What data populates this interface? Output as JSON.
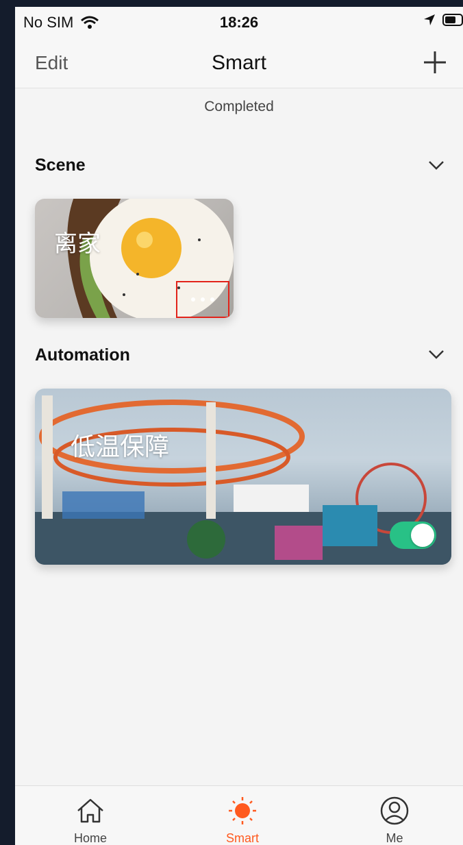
{
  "status_bar": {
    "carrier": "No SIM",
    "time": "18:26"
  },
  "nav": {
    "edit_label": "Edit",
    "title": "Smart"
  },
  "status_text": "Completed",
  "scene_section": {
    "title": "Scene",
    "items": [
      {
        "name": "离家"
      }
    ]
  },
  "automation_section": {
    "title": "Automation",
    "items": [
      {
        "name": "低温保障",
        "enabled": true
      }
    ]
  },
  "tabs": [
    {
      "label": "Home",
      "icon": "home-icon"
    },
    {
      "label": "Smart",
      "icon": "sun-icon",
      "active": true
    },
    {
      "label": "Me",
      "icon": "profile-icon"
    }
  ],
  "colors": {
    "accent": "#ff5a1f",
    "toggle_on": "#28c186",
    "highlight_box": "#e2231a"
  }
}
